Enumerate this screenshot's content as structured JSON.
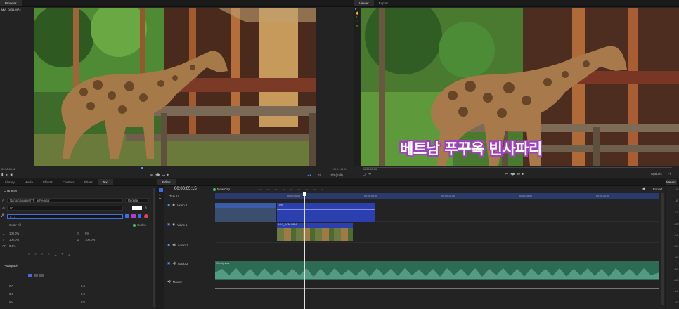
{
  "source_panel": {
    "tab": "Browser",
    "filename": "MVI_0436.MP4",
    "timecode_left": "00:00:08:12",
    "timecode_right": "00:01:11:04",
    "zoom": "Fit",
    "quality": "1/2 (Full)"
  },
  "program_panel": {
    "tabs": [
      "Viewer",
      "Export"
    ],
    "timecode_left": "00:00:05:15",
    "subtitle": "베트남 푸꾸옥 빈사파리",
    "options_label": "Options",
    "zoom": "Fit"
  },
  "left_tabs": [
    "Library",
    "Media",
    "Effects",
    "Controls",
    "Filters",
    "Text"
  ],
  "character": {
    "section": "Character",
    "font": "NanumSquareOTF_acRegular",
    "font_style": "Regular",
    "size": "80",
    "stroke_value": "4.77",
    "stroke_mode": "Outer Fill",
    "outline_label": "Outline",
    "scale_x": "100.0%",
    "scale_y": "100.0%",
    "rotation": "0%",
    "skew": "100.0%",
    "tracking": "0.0%"
  },
  "paragraph": {
    "section": "Paragraph",
    "values": [
      "0.0",
      "0.0",
      "0.0",
      "0.0",
      "0.0",
      "0.0"
    ]
  },
  "editor": {
    "tab": "Editor",
    "timecode": "00:00:05:15",
    "new_clip": "New Clip",
    "export": "Export",
    "title": "Title A1",
    "ruler": [
      "00:00:00:00",
      "00:00:05:00",
      "00:00:10:00",
      "00:00:15:00",
      "00:00:20:00",
      "00:00:25:00"
    ],
    "tracks": [
      {
        "name": "Video 2"
      },
      {
        "name": "Video 1"
      },
      {
        "name": "Audio 1"
      },
      {
        "name": "Audio 2"
      },
      {
        "name": "Master"
      }
    ],
    "clips": {
      "lower_third": "Stylish Lower Third 08",
      "text": "Text",
      "video": "MVI_0436.MP4",
      "audio": "Comfy.wav"
    }
  },
  "meters": {
    "tab": "Meters",
    "scale": [
      "0",
      "-6",
      "-12",
      "-18",
      "-24",
      "-30",
      "-36",
      "-42",
      "-48",
      "-54",
      "-60"
    ]
  },
  "colors": {
    "accent": "#3d6fe0",
    "clip_blue": "#2b3fae",
    "clip_lowerthird": "#3a4f6e",
    "audio_green": "#2e6b55",
    "wave": "#5aa088"
  }
}
